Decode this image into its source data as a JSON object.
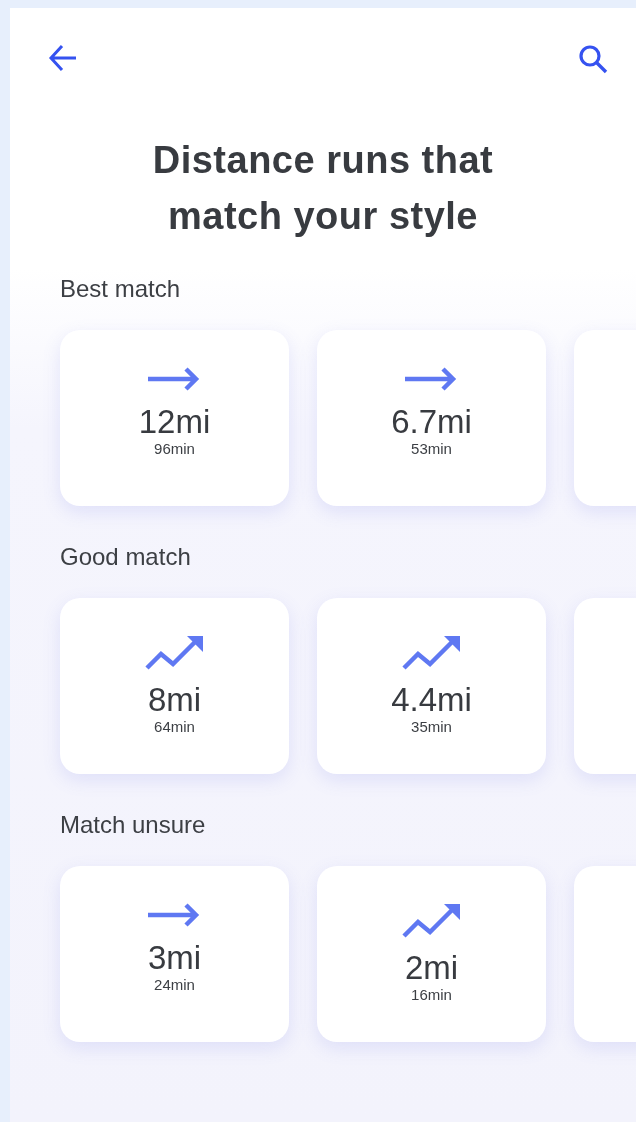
{
  "title": "Distance runs that match your style",
  "sections": [
    {
      "heading": "Best match",
      "runs": [
        {
          "kind": "steady",
          "distance": "12mi",
          "duration": "96min"
        },
        {
          "kind": "steady",
          "distance": "6.7mi",
          "duration": "53min"
        }
      ]
    },
    {
      "heading": "Good match",
      "runs": [
        {
          "kind": "trend",
          "distance": "8mi",
          "duration": "64min"
        },
        {
          "kind": "trend",
          "distance": "4.4mi",
          "duration": "35min"
        }
      ]
    },
    {
      "heading": "Match unsure",
      "runs": [
        {
          "kind": "steady",
          "distance": "3mi",
          "duration": "24min"
        },
        {
          "kind": "trend",
          "distance": "2mi",
          "duration": "16min"
        }
      ]
    }
  ]
}
